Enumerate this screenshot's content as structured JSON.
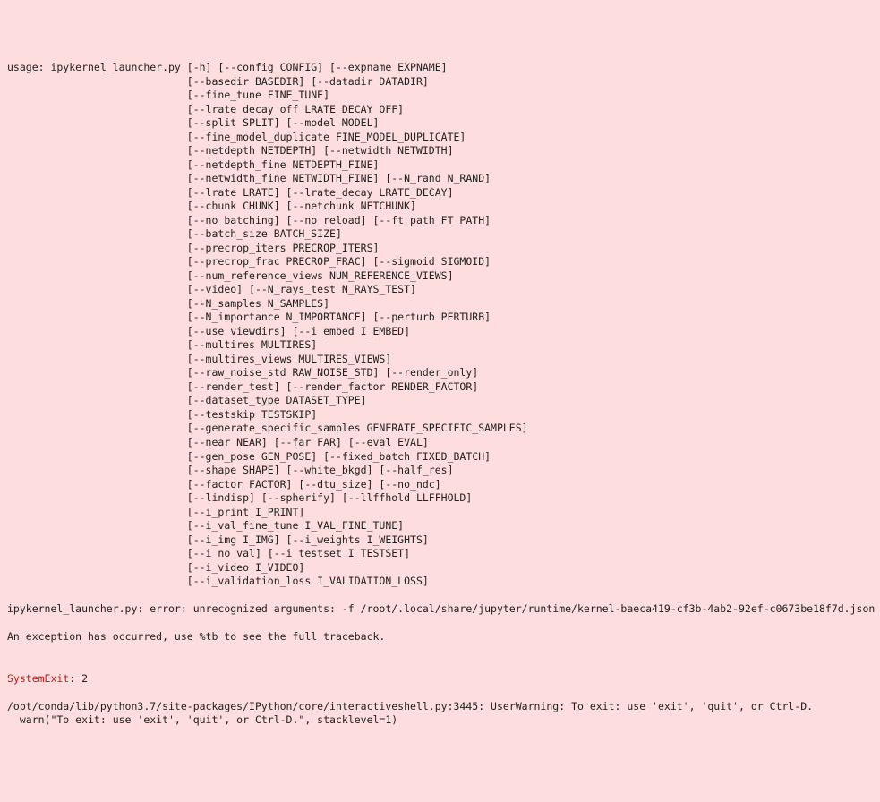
{
  "usage_lines": [
    "usage: ipykernel_launcher.py [-h] [--config CONFIG] [--expname EXPNAME]",
    "                             [--basedir BASEDIR] [--datadir DATADIR]",
    "                             [--fine_tune FINE_TUNE]",
    "                             [--lrate_decay_off LRATE_DECAY_OFF]",
    "                             [--split SPLIT] [--model MODEL]",
    "                             [--fine_model_duplicate FINE_MODEL_DUPLICATE]",
    "                             [--netdepth NETDEPTH] [--netwidth NETWIDTH]",
    "                             [--netdepth_fine NETDEPTH_FINE]",
    "                             [--netwidth_fine NETWIDTH_FINE] [--N_rand N_RAND]",
    "                             [--lrate LRATE] [--lrate_decay LRATE_DECAY]",
    "                             [--chunk CHUNK] [--netchunk NETCHUNK]",
    "                             [--no_batching] [--no_reload] [--ft_path FT_PATH]",
    "                             [--batch_size BATCH_SIZE]",
    "                             [--precrop_iters PRECROP_ITERS]",
    "                             [--precrop_frac PRECROP_FRAC] [--sigmoid SIGMOID]",
    "                             [--num_reference_views NUM_REFERENCE_VIEWS]",
    "                             [--video] [--N_rays_test N_RAYS_TEST]",
    "                             [--N_samples N_SAMPLES]",
    "                             [--N_importance N_IMPORTANCE] [--perturb PERTURB]",
    "                             [--use_viewdirs] [--i_embed I_EMBED]",
    "                             [--multires MULTIRES]",
    "                             [--multires_views MULTIRES_VIEWS]",
    "                             [--raw_noise_std RAW_NOISE_STD] [--render_only]",
    "                             [--render_test] [--render_factor RENDER_FACTOR]",
    "                             [--dataset_type DATASET_TYPE]",
    "                             [--testskip TESTSKIP]",
    "                             [--generate_specific_samples GENERATE_SPECIFIC_SAMPLES]",
    "                             [--near NEAR] [--far FAR] [--eval EVAL]",
    "                             [--gen_pose GEN_POSE] [--fixed_batch FIXED_BATCH]",
    "                             [--shape SHAPE] [--white_bkgd] [--half_res]",
    "                             [--factor FACTOR] [--dtu_size] [--no_ndc]",
    "                             [--lindisp] [--spherify] [--llffhold LLFFHOLD]",
    "                             [--i_print I_PRINT]",
    "                             [--i_val_fine_tune I_VAL_FINE_TUNE]",
    "                             [--i_img I_IMG] [--i_weights I_WEIGHTS]",
    "                             [--i_no_val] [--i_testset I_TESTSET]",
    "                             [--i_video I_VIDEO]",
    "                             [--i_validation_loss I_VALIDATION_LOSS]"
  ],
  "error_line": "ipykernel_launcher.py: error: unrecognized arguments: -f /root/.local/share/jupyter/runtime/kernel-baeca419-cf3b-4ab2-92ef-c0673be18f7d.json",
  "exception_line": "An exception has occurred, use %tb to see the full traceback.",
  "systemexit": {
    "name": "SystemExit",
    "sep": ": ",
    "value": "2"
  },
  "warn_lines": [
    "/opt/conda/lib/python3.7/site-packages/IPython/core/interactiveshell.py:3445: UserWarning: To exit: use 'exit', 'quit', or Ctrl-D.",
    "  warn(\"To exit: use 'exit', 'quit', or Ctrl-D.\", stacklevel=1)"
  ]
}
